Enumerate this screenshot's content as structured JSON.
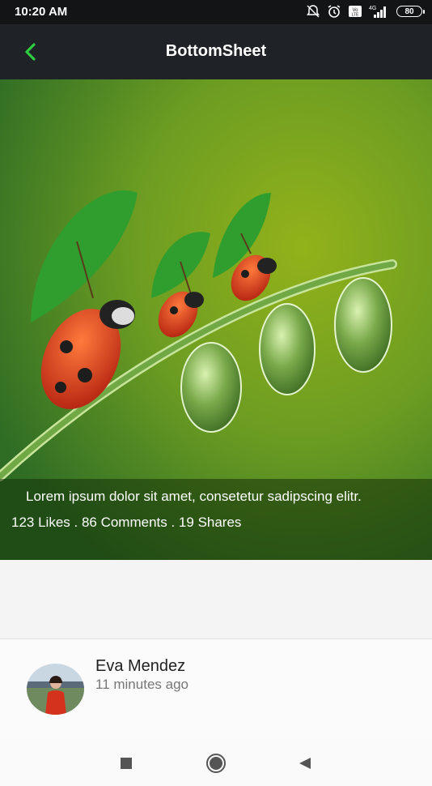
{
  "status_bar": {
    "time": "10:20 AM",
    "icons": [
      "mute-bell-icon",
      "alarm-icon",
      "volte-icon",
      "signal-4g-icon"
    ],
    "network_label": "4G",
    "battery": "80"
  },
  "app_bar": {
    "title": "BottomSheet",
    "back_icon": "chevron-left-icon",
    "accent_color": "#2ecc40"
  },
  "hero": {
    "image": "ladybugs-with-umbrellas-on-grass-stem",
    "caption": "Lorem ipsum dolor sit amet, consetetur sadipscing elitr.",
    "stats": "123 Likes . 86 Comments . 19 Shares"
  },
  "bottom_sheet": {
    "user_name": "Eva Mendez",
    "time_ago": "11 minutes ago",
    "avatar": "user-avatar-photo"
  },
  "nav_bar": {
    "buttons": [
      "recents-square-icon",
      "home-circle-icon",
      "back-triangle-icon"
    ]
  }
}
